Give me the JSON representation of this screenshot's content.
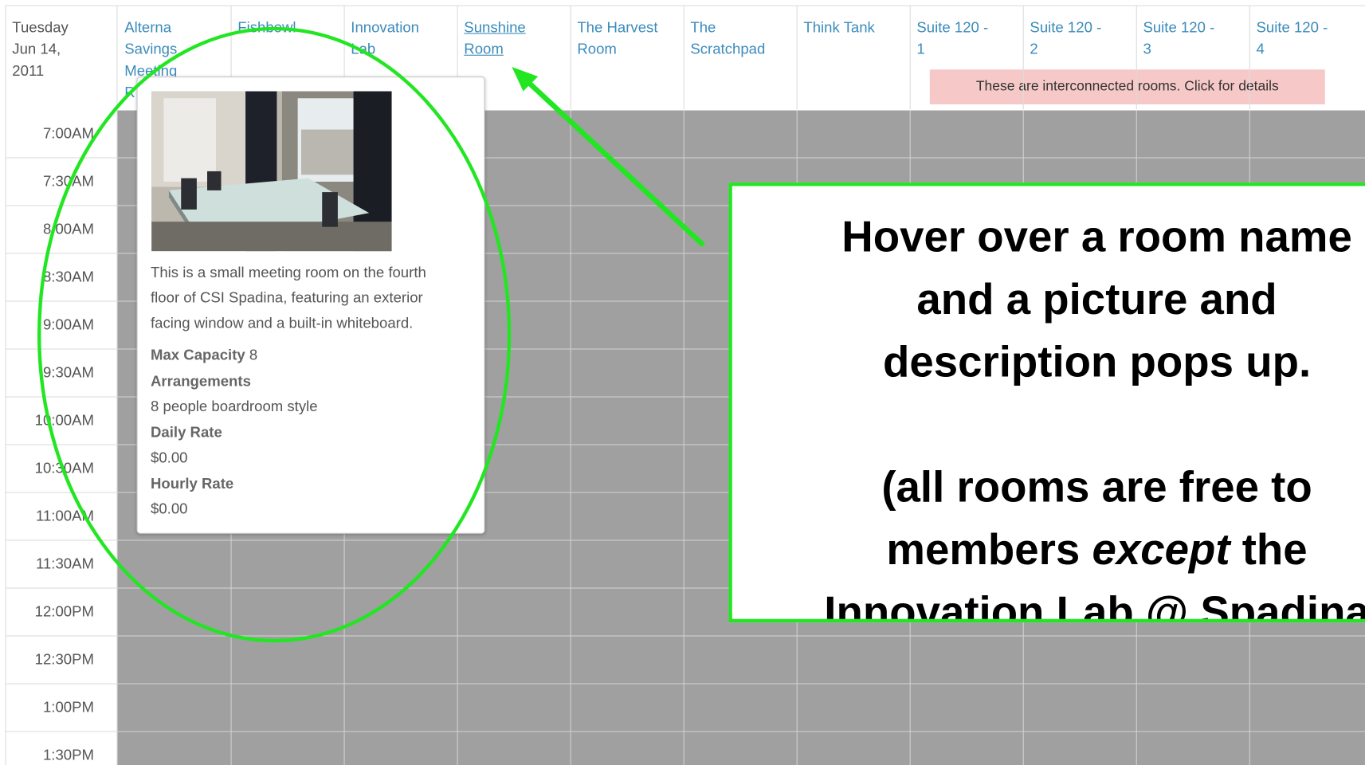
{
  "schedule": {
    "date": [
      "Tuesday",
      "Jun 14,",
      "2011"
    ],
    "rooms": [
      {
        "lines": [
          "Alterna",
          "Savings",
          "Meeting",
          "R"
        ]
      },
      {
        "lines": [
          "Fishbowl"
        ]
      },
      {
        "lines": [
          "Innovation",
          "Lab"
        ]
      },
      {
        "lines": [
          "Sunshine",
          "Room"
        ]
      },
      {
        "lines": [
          "The Harvest",
          "Room"
        ]
      },
      {
        "lines": [
          "The",
          "Scratchpad"
        ]
      },
      {
        "lines": [
          "Think Tank"
        ]
      },
      {
        "lines": [
          "Suite 120 -",
          "1"
        ]
      },
      {
        "lines": [
          "Suite 120 -",
          "2"
        ]
      },
      {
        "lines": [
          "Suite 120 -",
          "3"
        ]
      },
      {
        "lines": [
          "Suite 120 -",
          "4"
        ]
      }
    ],
    "connected_note": "These are interconnected rooms. Click for details",
    "times": [
      "7:00AM",
      "7:30AM",
      "8:00AM",
      "8:30AM",
      "9:00AM",
      "9:30AM",
      "10:00AM",
      "10:30AM",
      "11:00AM",
      "11:30AM",
      "12:00PM",
      "12:30PM",
      "1:00PM",
      "1:30PM"
    ]
  },
  "popup": {
    "description": [
      "This is a small meeting room on the fourth",
      "floor of CSI Spadina, featuring an exterior",
      "facing window and a built-in whiteboard."
    ],
    "max_capacity_label": "Max Capacity",
    "max_capacity_value": "8",
    "arrangements_label": "Arrangements",
    "arrangements_value": "8 people boardroom style",
    "daily_rate_label": "Daily Rate",
    "daily_rate_value": "$0.00",
    "hourly_rate_label": "Hourly Rate",
    "hourly_rate_value": "$0.00"
  },
  "annotation": {
    "lines": [
      "Hover over a room name",
      "and a picture and",
      "description pops up.",
      "",
      "(all rooms are free to",
      "members "
    ],
    "except_word": "except",
    "after_except": " the",
    "last_line": "Innovation Lab @ Spadina"
  },
  "colors": {
    "annotation_green": "#22e622",
    "link_blue": "#3b8bbb",
    "slot_gray": "#a0a0a0",
    "connected_note_bg": "#f6c8c8"
  }
}
